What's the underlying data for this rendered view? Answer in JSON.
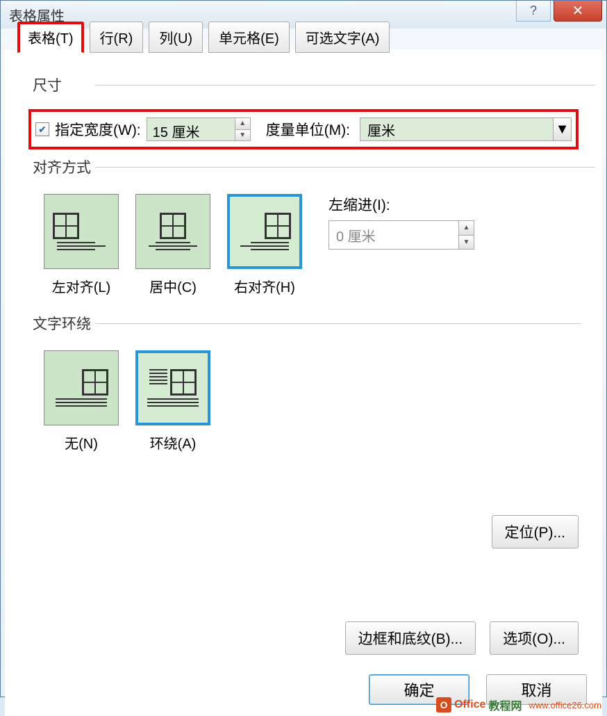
{
  "window": {
    "title": "表格属性"
  },
  "tabs": {
    "table": "表格(T)",
    "row": "行(R)",
    "column": "列(U)",
    "cell": "单元格(E)",
    "alttext": "可选文字(A)"
  },
  "size": {
    "group_label": "尺寸",
    "checkbox_label": "指定宽度(W):",
    "width_value": "15 厘米",
    "measure_label": "度量单位(M):",
    "unit_value": "厘米"
  },
  "alignment": {
    "group_label": "对齐方式",
    "left": "左对齐(L)",
    "center": "居中(C)",
    "right": "右对齐(H)",
    "indent_label": "左缩进(I):",
    "indent_value": "0 厘米"
  },
  "wrap": {
    "group_label": "文字环绕",
    "none": "无(N)",
    "around": "环绕(A)",
    "position_btn": "定位(P)..."
  },
  "buttons": {
    "border": "边框和底纹(B)...",
    "options": "选项(O)...",
    "ok": "确定",
    "cancel": "取消"
  },
  "watermark": {
    "text": "Office教程网",
    "url": "www.office26.com"
  }
}
